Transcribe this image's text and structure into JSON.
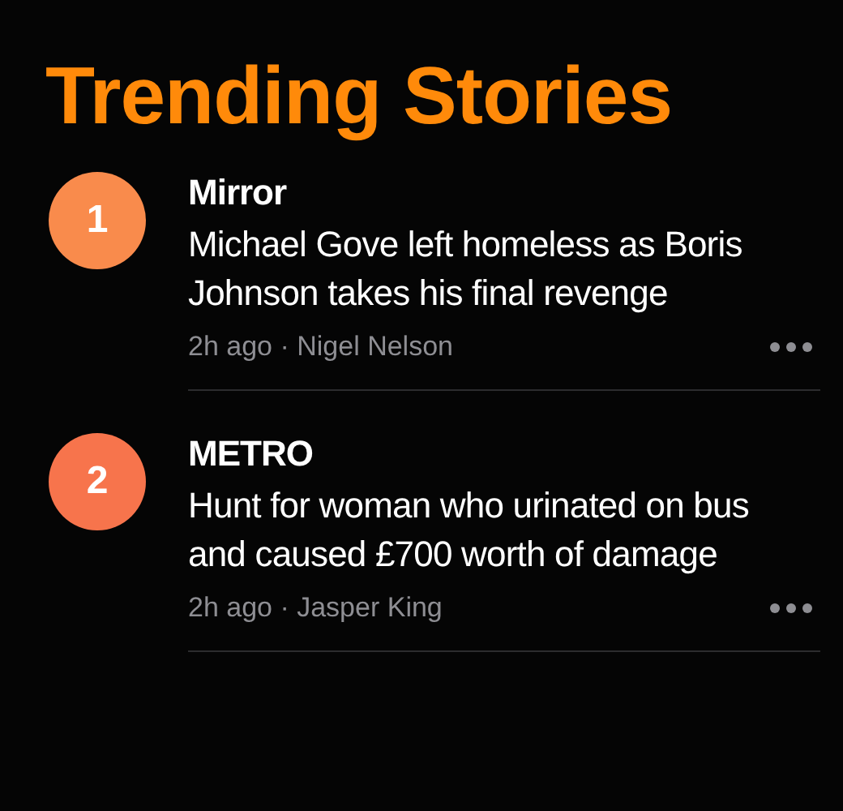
{
  "title": "Trending Stories",
  "stories": [
    {
      "rank": "1",
      "color": "#f98b4c",
      "publisher": "Mirror",
      "headline": "Michael Gove left homeless as Boris Johnson takes his final revenge",
      "meta": "2h ago · Nigel Nelson"
    },
    {
      "rank": "2",
      "color": "#f7744c",
      "publisher": "METRO",
      "headline": "Hunt for woman who urinated on bus and caused £700 worth of damage",
      "meta": "2h ago · Jasper King"
    }
  ]
}
